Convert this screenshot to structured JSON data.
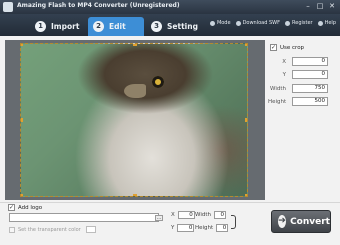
{
  "window": {
    "title": "Amazing Flash to MP4 Converter (Unregistered)",
    "controls": [
      "–",
      "□",
      "✕"
    ]
  },
  "tabs": [
    {
      "num": "1",
      "label": "Import"
    },
    {
      "num": "2",
      "label": "Edit",
      "active": true
    },
    {
      "num": "3",
      "label": "Setting"
    }
  ],
  "menu": {
    "mode": "Mode",
    "download": "Download SWF",
    "register": "Register",
    "help": "Help"
  },
  "crop": {
    "label": "Use crop",
    "checked": true,
    "x_label": "X",
    "x_value": "0",
    "y_label": "Y",
    "y_value": "0",
    "width_label": "Width",
    "width_value": "750",
    "height_label": "Height",
    "height_value": "500"
  },
  "logo": {
    "label": "Add logo",
    "checked": true,
    "path_value": "",
    "browse_label": "...",
    "transparent_label": "Set the transparent color",
    "x_label": "X",
    "x_value": "0",
    "y_label": "Y",
    "y_value": "0",
    "width_label": "Width",
    "width_value": "0",
    "height_label": "Height",
    "height_value": "0"
  },
  "convert": {
    "label": "Convert",
    "icon": "convert-arrow-icon"
  },
  "colors": {
    "toolbar": "#2a3441",
    "active_tab": "#3d8ed6",
    "crop_border": "#b58a2e"
  }
}
